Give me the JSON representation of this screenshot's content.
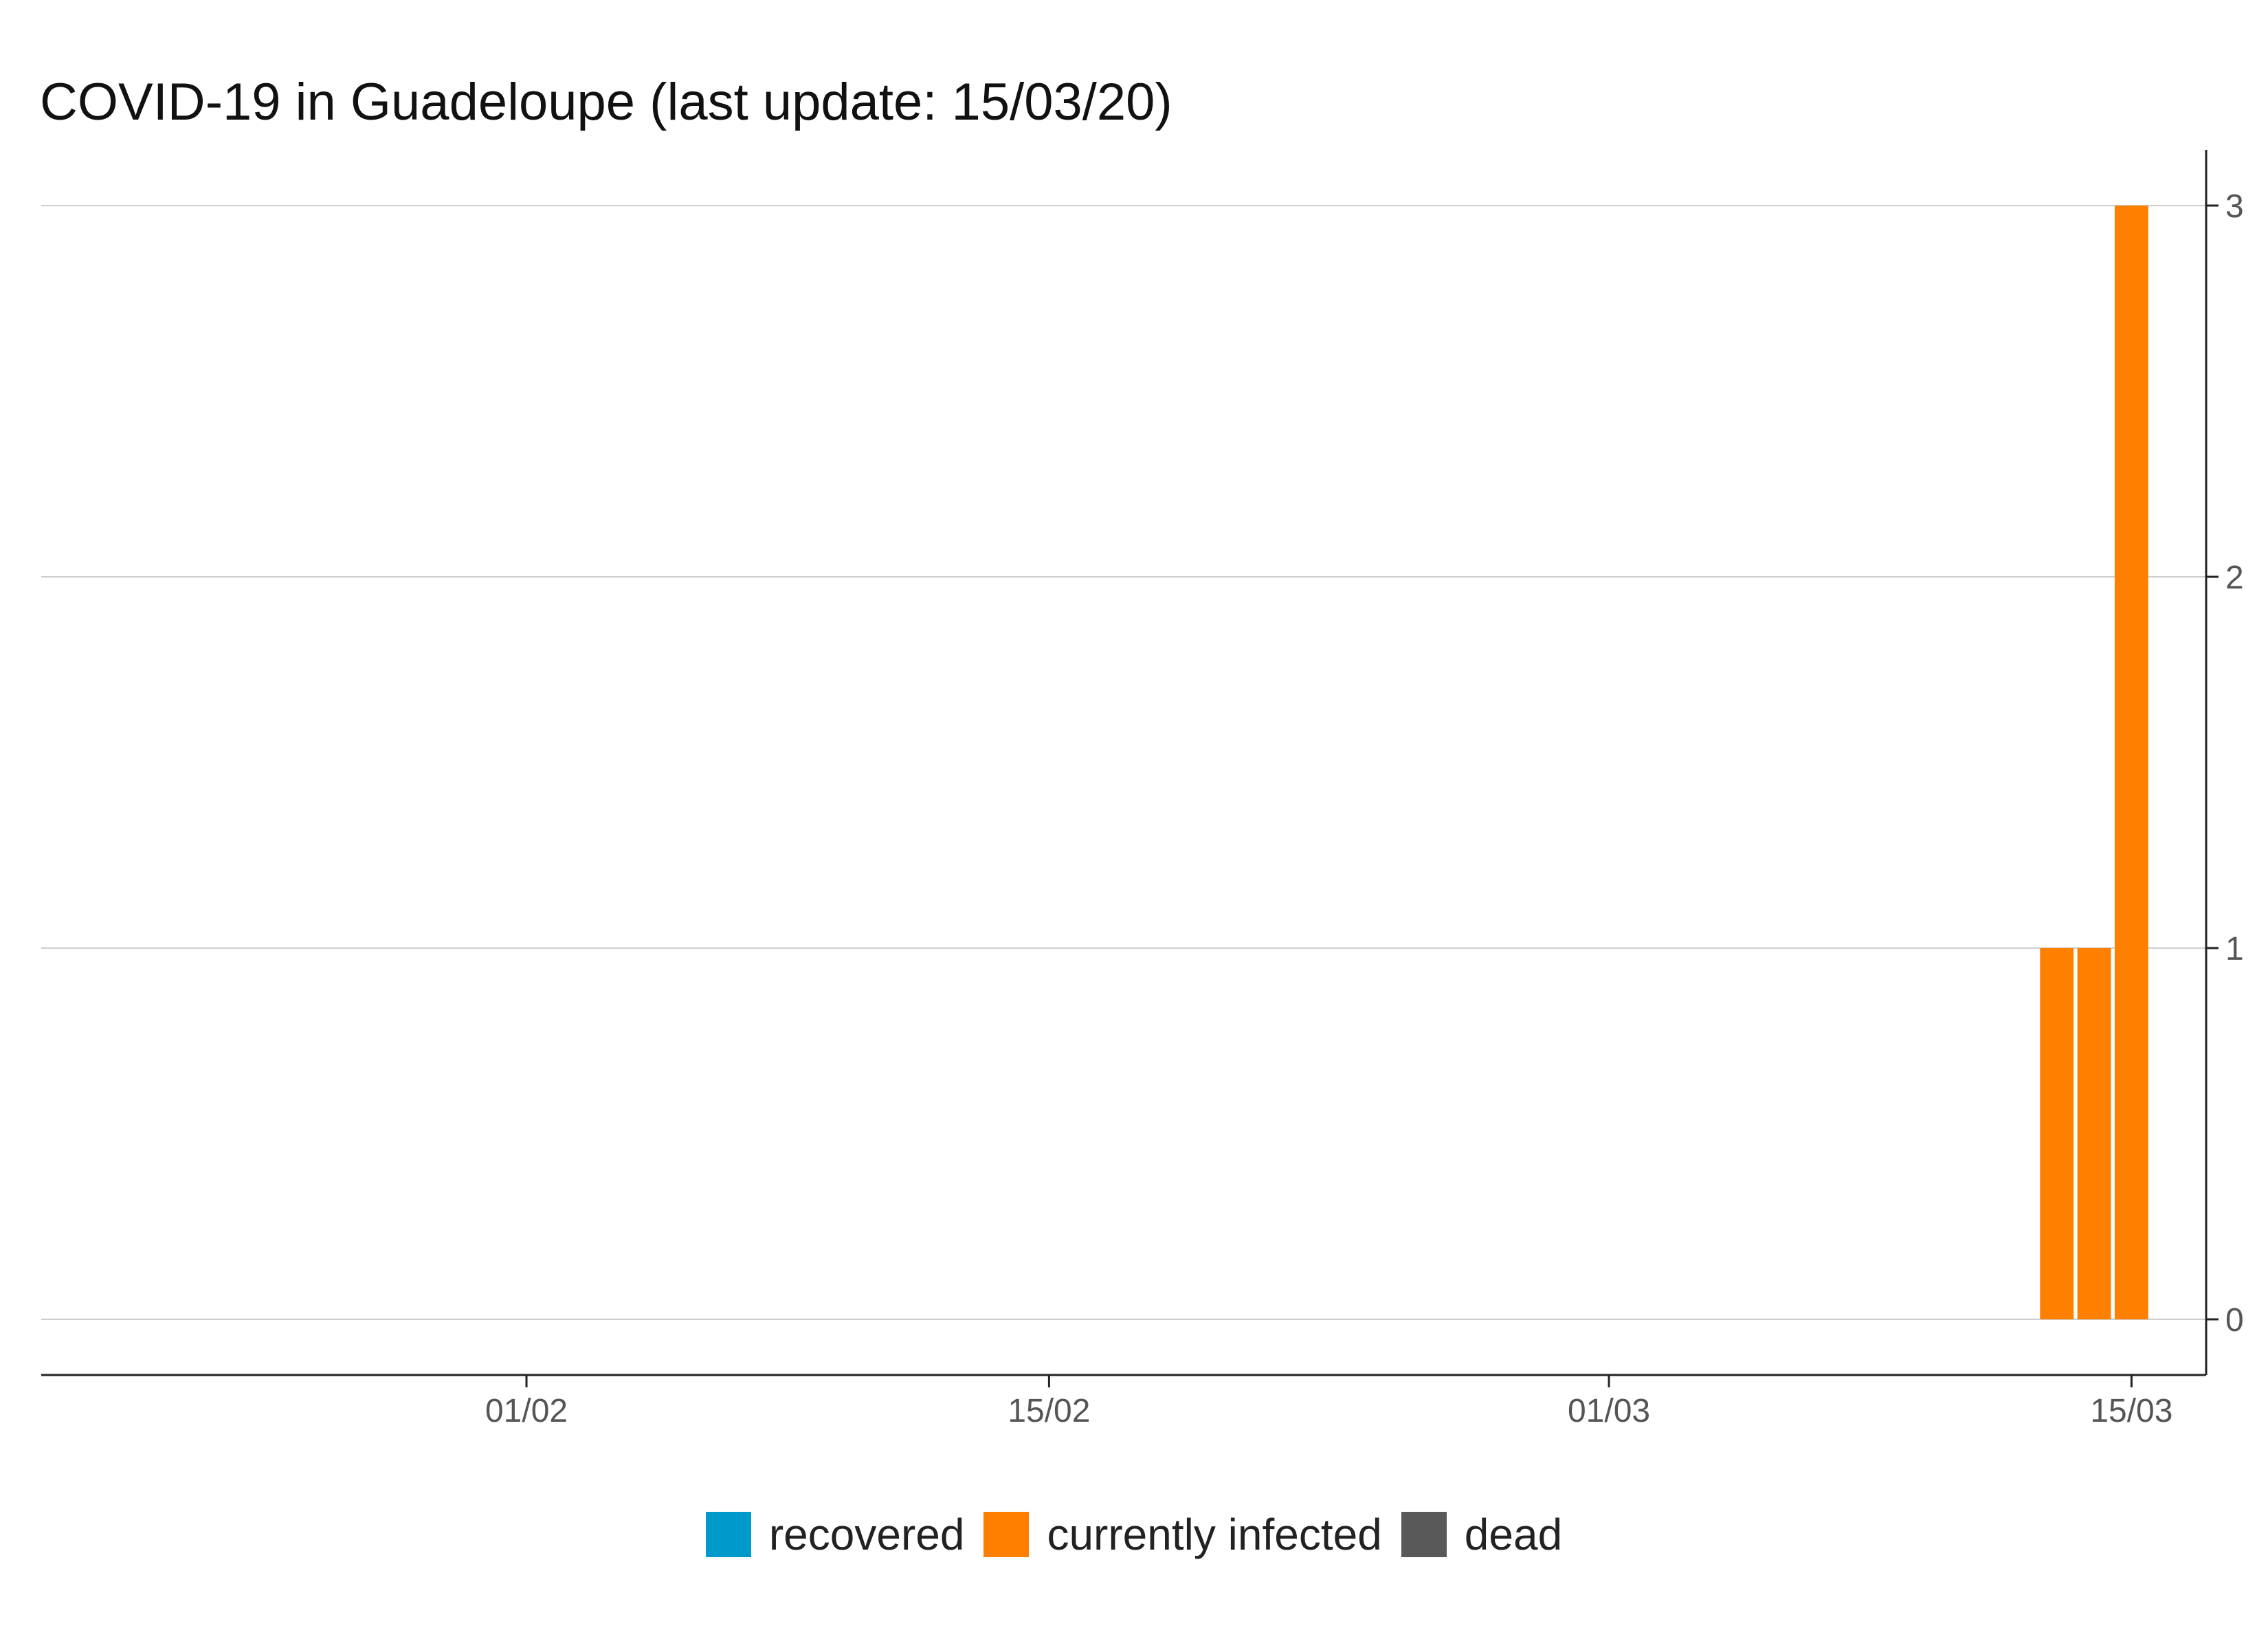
{
  "chart_data": {
    "type": "bar",
    "title": "COVID-19 in Guadeloupe (last update: 15/03/20)",
    "xlabel": "",
    "ylabel": "",
    "x_axis": {
      "type": "date",
      "ticks": [
        "01/02",
        "15/02",
        "01/03",
        "15/03"
      ],
      "range": [
        "2020-01-19",
        "2020-03-17"
      ]
    },
    "y_axis": {
      "position": "right",
      "ticks": [
        0,
        1,
        2,
        3
      ],
      "ylim": [
        -0.15,
        3.15
      ]
    },
    "grid": {
      "horizontal": true,
      "vertical": false
    },
    "stacked": true,
    "legend_position": "bottom",
    "series": [
      {
        "name": "recovered",
        "color": "#0099CC",
        "x": [
          "2020-03-13",
          "2020-03-14",
          "2020-03-15"
        ],
        "values": [
          0,
          0,
          0
        ]
      },
      {
        "name": "currently infected",
        "color": "#FF8000",
        "x": [
          "2020-03-13",
          "2020-03-14",
          "2020-03-15"
        ],
        "values": [
          1,
          1,
          3
        ]
      },
      {
        "name": "dead",
        "color": "#595959",
        "x": [
          "2020-03-13",
          "2020-03-14",
          "2020-03-15"
        ],
        "values": [
          0,
          0,
          0
        ]
      }
    ]
  }
}
